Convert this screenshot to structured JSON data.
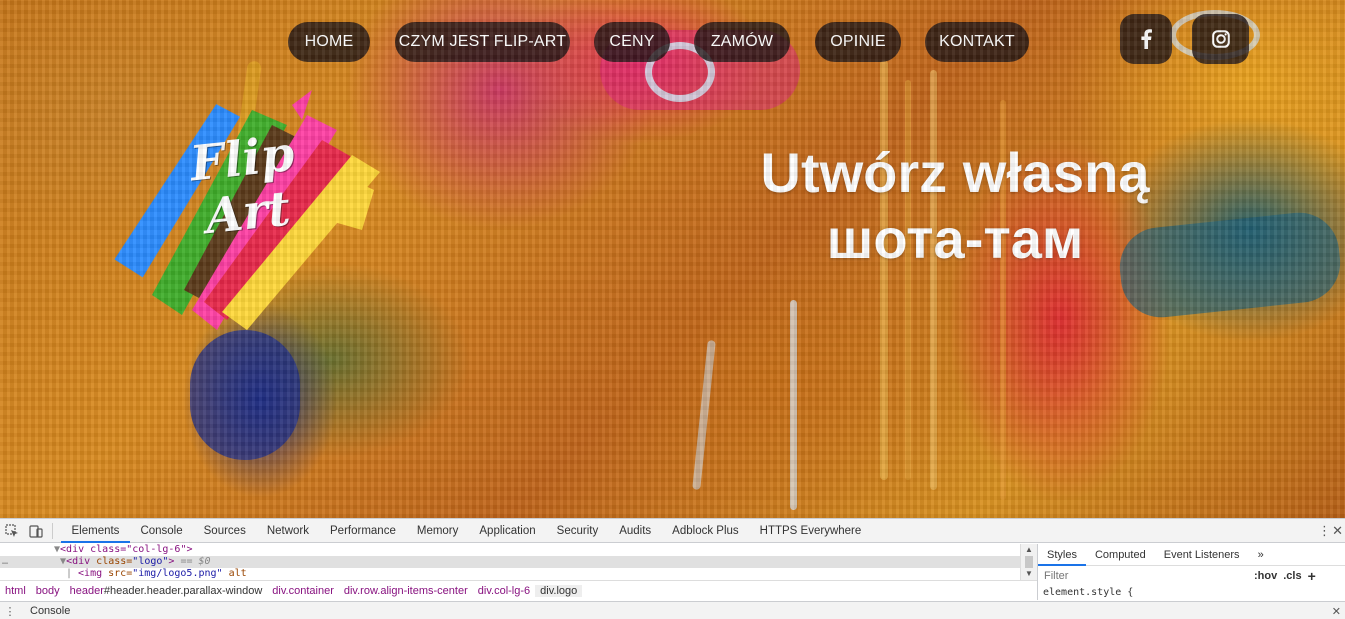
{
  "nav": {
    "items": [
      {
        "label": "HOME"
      },
      {
        "label": "CZYM JEST FLIP-ART"
      },
      {
        "label": "CENY"
      },
      {
        "label": "ZAMÓW"
      },
      {
        "label": "OPINIE"
      },
      {
        "label": "KONTAKT"
      }
    ]
  },
  "social": {
    "facebook_icon": "facebook-icon",
    "instagram_icon": "instagram-icon"
  },
  "logo": {
    "line1": "Flip",
    "line2": "Art",
    "colors": [
      "#2b8cff",
      "#3fae2a",
      "#5b3a1a",
      "#e8284a",
      "#ff3fa4",
      "#ffd83a"
    ]
  },
  "hero": {
    "headline_line1": "Utwórz własną",
    "headline_line2": "шота-там"
  },
  "devtools": {
    "tabs": [
      "Elements",
      "Console",
      "Sources",
      "Network",
      "Performance",
      "Memory",
      "Application",
      "Security",
      "Audits",
      "Adblock Plus",
      "HTTPS Everywhere"
    ],
    "active_tab": "Elements",
    "dom": {
      "line1_tag": "<div class=\"col-lg-6\">",
      "line2_open": "<div ",
      "line2_attr": "class=",
      "line2_val": "\"logo\"",
      "line2_close": ">",
      "line2_suffix": " == $0",
      "line3_tag": "<img ",
      "line3_attr1": "src=",
      "line3_val1": "\"img/logo5.png\"",
      "line3_attr2": " alt"
    },
    "breadcrumbs": [
      {
        "tag": "html",
        "rest": ""
      },
      {
        "tag": "body",
        "rest": ""
      },
      {
        "tag": "header",
        "rest": "#header.header.parallax-window"
      },
      {
        "tag": "div",
        "rest": ".container"
      },
      {
        "tag": "div",
        "rest": ".row.align-items-center"
      },
      {
        "tag": "div",
        "rest": ".col-lg-6"
      },
      {
        "tag": "div",
        "rest": ".logo"
      }
    ],
    "styles_tabs": [
      "Styles",
      "Computed",
      "Event Listeners",
      "»"
    ],
    "filter_placeholder": "Filter",
    "hov_label": ":hov",
    "cls_label": ".cls",
    "add_label": "+",
    "rule_text": "element.style {",
    "drawer_label": "Console",
    "menu_glyph": "⋮",
    "close_glyph": "✕",
    "drawer_menu_glyph": "⋮"
  },
  "colors": {
    "nav_bg": "rgba(30,20,20,0.82)",
    "accent_blue": "#1a73e8",
    "tag_color": "#881280"
  }
}
